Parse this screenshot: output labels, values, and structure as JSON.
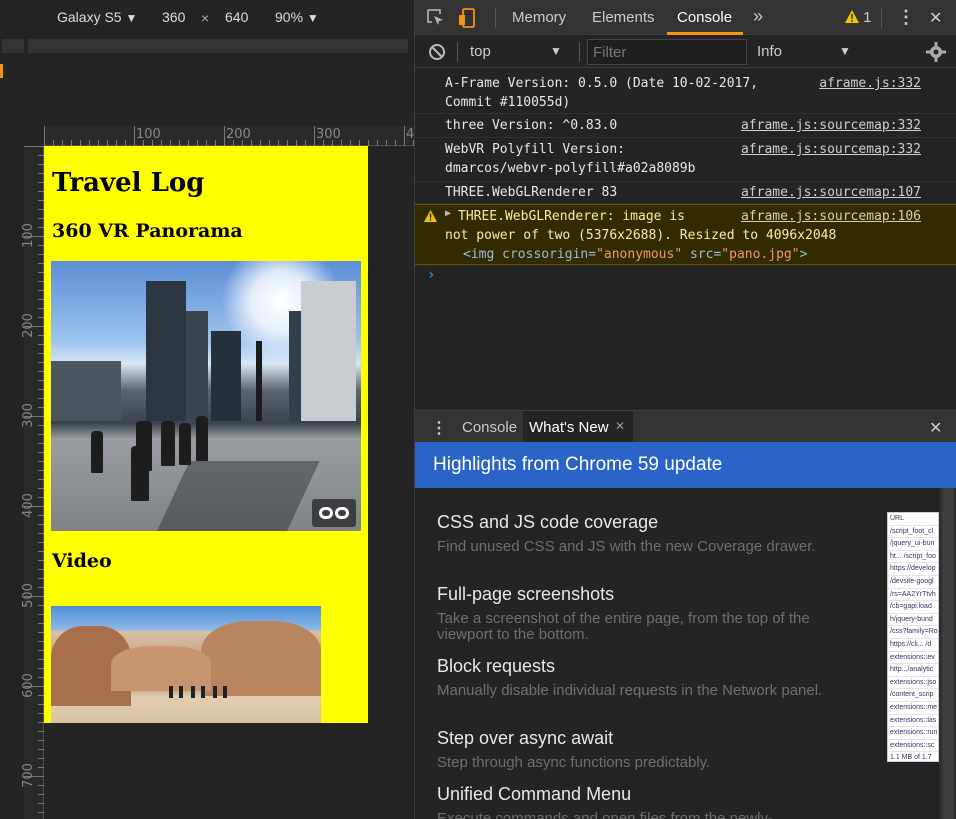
{
  "device_toolbar": {
    "device": "Galaxy S5",
    "width": "360",
    "times": "×",
    "height": "640",
    "zoom": "90%",
    "caret": "▼"
  },
  "rulers": {
    "top": [
      "100",
      "200",
      "300",
      "4"
    ],
    "left": [
      "100",
      "200",
      "300",
      "400",
      "500",
      "600",
      "700"
    ]
  },
  "page": {
    "title": "Travel Log",
    "panorama_heading": "360 VR Panorama",
    "video_heading": "Video"
  },
  "devtools": {
    "tabs": [
      "Memory",
      "Elements",
      "Console"
    ],
    "active_tab": "Console",
    "more": "»",
    "warning_count": "1",
    "menu": "⋮",
    "close": "✕"
  },
  "console_toolbar": {
    "context": "top",
    "filter_placeholder": "Filter",
    "level": "Info"
  },
  "console_messages": [
    {
      "text": "A-Frame Version: 0.5.0 (Date 10-02-2017,\nCommit #110055d)",
      "source": "aframe.js:332",
      "level": "log"
    },
    {
      "text": "three Version: ^0.83.0",
      "source": "aframe.js:sourcemap:332",
      "level": "log"
    },
    {
      "text": "WebVR Polyfill Version:\ndmarcos/webvr-polyfill#a02a8089b",
      "source": "aframe.js:sourcemap:332",
      "level": "log"
    },
    {
      "text": "THREE.WebGLRenderer 83",
      "source": "aframe.js:sourcemap:107",
      "level": "log"
    },
    {
      "text_line1": "THREE.WebGLRenderer: image is",
      "text_line2": "not power of two (5376x2688). Resized to 4096x2048",
      "source": "aframe.js:sourcemap:106",
      "level": "warning",
      "img_tag_open": "<img ",
      "img_attr1": "crossorigin=",
      "img_val1": "\"anonymous\"",
      "img_attr2": " src=",
      "img_val2": "\"pano.jpg\"",
      "img_tag_close": ">"
    }
  ],
  "console_prompt": "›",
  "drawer": {
    "tabs": [
      "Console",
      "What's New"
    ],
    "close_tab": "✕",
    "close": "✕",
    "highlights": "Highlights from Chrome 59 update",
    "items": [
      {
        "title": "CSS and JS code coverage",
        "desc": "Find unused CSS and JS with the new Coverage drawer."
      },
      {
        "title": "Full-page screenshots",
        "desc": "Take a screenshot of the entire page, from the top of the viewport to the bottom."
      },
      {
        "title": "Block requests",
        "desc": "Manually disable individual requests in the Network panel."
      },
      {
        "title": "Step over async await",
        "desc": "Step through async functions predictably."
      },
      {
        "title": "Unified Command Menu",
        "desc": "Execute commands and open files from the newly-"
      }
    ],
    "thumb_rows": [
      "URL",
      "/script_foot_cl",
      "/jquery_ui-bun",
      "ht... /script_foo",
      "https://develop",
      "/devsite-googl",
      "/rs=AA2YrTtvh",
      "/cb=gapi.load",
      "h/jquery-bund",
      "/css?family=Ro",
      "https://cli... /d",
      "extensions::ev",
      "http.../analytic",
      "extensions::jso",
      "/content_scrip",
      "extensions::me",
      "extensions::las",
      "extensions::run",
      "extensions::sc",
      "1.1 MB of 1.7"
    ]
  },
  "colors": {
    "page_bg": "#ffff00",
    "accent": "#f29513",
    "highlight_bar": "#2b63c6",
    "warn_bg": "#332b00"
  }
}
